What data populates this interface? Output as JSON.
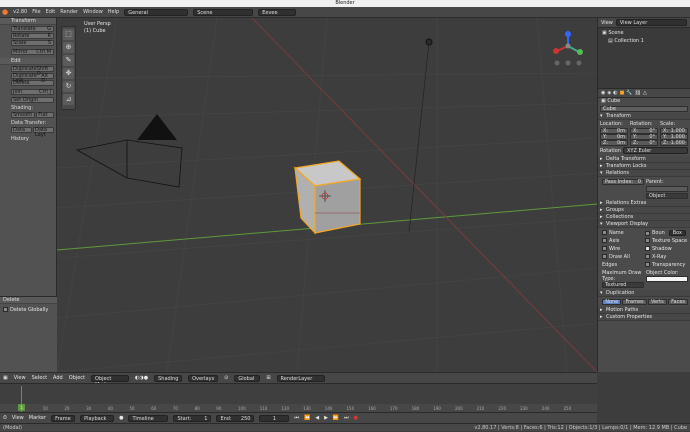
{
  "window": {
    "title": "Blender"
  },
  "topbar": {
    "version": "v2.80",
    "menus": [
      "File",
      "Edit",
      "Render",
      "Window",
      "Help"
    ],
    "workspace": "General",
    "scene": "Scene",
    "engine": "Eevee"
  },
  "left_panel": {
    "transform_header": "Transform",
    "transform_items": [
      {
        "label": "Translate",
        "key": "G"
      },
      {
        "label": "Rotate",
        "key": "R"
      },
      {
        "label": "Scale",
        "key": "S"
      },
      {
        "label": "Mirror",
        "key": "Ctrl M"
      }
    ],
    "edit_header": "Edit",
    "edit_items": [
      {
        "label": "Duplicate",
        "key": "Shift D"
      },
      {
        "label": "Duplicate Link",
        "key": "Alt D"
      },
      {
        "label": "Delete",
        "key": ""
      },
      {
        "label": "Join",
        "key": "Ctrl J"
      },
      {
        "label": "Set Origin",
        "key": ""
      }
    ],
    "shading_label": "Shading:",
    "smooth": "Smooth",
    "flat": "Flat",
    "data_transfer_label": "Data Transfer:",
    "data": "Data",
    "data_layout": "Data Layt",
    "history_header": "History",
    "delete_header": "Delete",
    "delete_globally": "Delete Globally"
  },
  "viewport": {
    "view_name": "User Persp",
    "object_name": "(1) Cube"
  },
  "outliner": {
    "view_tab": "View",
    "view_layer": "View Layer",
    "scene": "Scene",
    "collection": "Collection 1"
  },
  "properties": {
    "object_name": "Cube",
    "object_field": "Cube",
    "transform": "Transform",
    "location_label": "Location:",
    "rotation_label": "Rotation:",
    "scale_label": "Scale:",
    "loc": [
      {
        "axis": "X:",
        "v": "0m"
      },
      {
        "axis": "Y:",
        "v": "0m"
      },
      {
        "axis": "Z:",
        "v": "0m"
      }
    ],
    "rot": [
      {
        "axis": "X:",
        "v": "0°"
      },
      {
        "axis": "Y:",
        "v": "0°"
      },
      {
        "axis": "Z:",
        "v": "0°"
      }
    ],
    "scl": [
      {
        "axis": "X:",
        "v": "1.000"
      },
      {
        "axis": "Y:",
        "v": "1.000"
      },
      {
        "axis": "Z:",
        "v": "1.000"
      }
    ],
    "rotation_mode_label": "Rotation",
    "rotation_mode": "XYZ Euler",
    "delta_transform": "Delta Transform",
    "transform_locks": "Transform Locks",
    "relations": "Relations",
    "pass_index_label": "Pass Index:",
    "pass_index": "0",
    "parent_label": "Parent:",
    "parent_type": "Object",
    "relations_extras": "Relations Extras",
    "groups": "Groups",
    "collections": "Collections",
    "viewport_display": "Viewport Display",
    "vd_left": [
      "Name",
      "Axis",
      "Wire",
      "Draw All Edges"
    ],
    "vd_right": [
      "Texture Space",
      "Shadow",
      "X-Ray",
      "Transparency"
    ],
    "bounds": "Boun",
    "bounds_type": "Box",
    "max_draw_type_label": "Maximum Draw Type:",
    "max_draw_type": "Textured",
    "object_color_label": "Object Color:",
    "duplication": "Duplication",
    "dup_options": [
      "None",
      "Frames",
      "Verts",
      "Faces"
    ],
    "motion_paths": "Motion Paths",
    "custom_properties": "Custom Properties"
  },
  "vp_header": {
    "items": [
      "View",
      "Select",
      "Add",
      "Object"
    ],
    "mode": "Object Mode",
    "shading": "Shading",
    "overlays": "Overlays",
    "orientation": "Global",
    "render_layer": "RenderLayer"
  },
  "timeline": {
    "ticks": [
      "0",
      "10",
      "20",
      "30",
      "40",
      "50",
      "60",
      "70",
      "80",
      "90",
      "100",
      "110",
      "120",
      "130",
      "140",
      "150",
      "160",
      "170",
      "180",
      "190",
      "200",
      "210",
      "220",
      "230",
      "240",
      "250"
    ],
    "current_frame": "1"
  },
  "tl_header": {
    "items": [
      "View",
      "Marker",
      "Frame",
      "Playback"
    ],
    "editor": "Timeline",
    "start_label": "Start:",
    "start": "1",
    "end_label": "End:",
    "end": "250",
    "current": "1"
  },
  "status": {
    "left": "(Modal)",
    "right": "v2.80.17 | Verts:8 | Faces:6 | Tris:12 | Objects:1/3 | Lamps:0/1 | Mem: 12.9 MB | Cube"
  }
}
